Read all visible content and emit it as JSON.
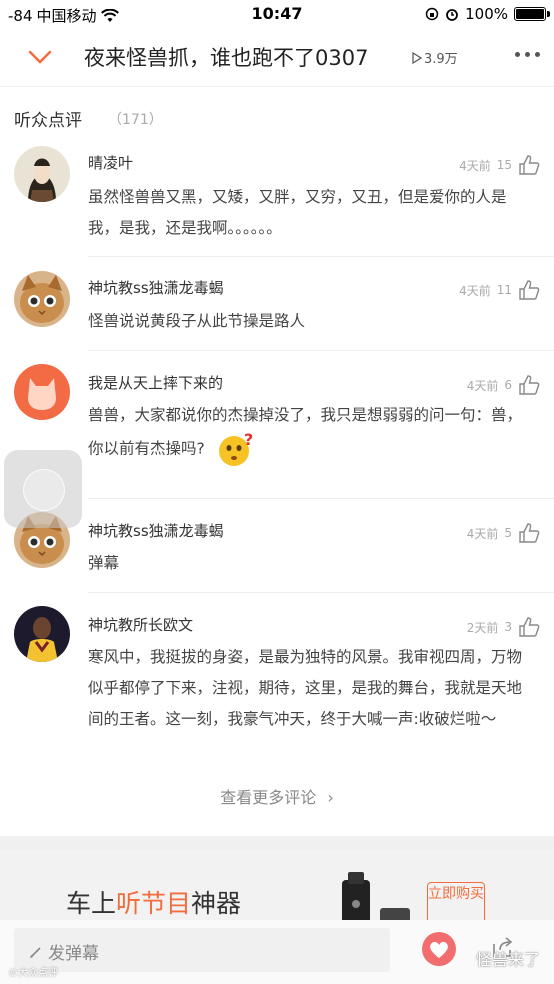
{
  "status_bar": {
    "signal": "-84",
    "carrier": "中国移动",
    "time": "10:47",
    "battery": "100%"
  },
  "header": {
    "title": "夜来怪兽抓，谁也跑不了0307",
    "plays": "3.9万"
  },
  "section": {
    "title": "听众点评",
    "count": "（171）"
  },
  "comments": [
    {
      "name": "晴凌叶",
      "time": "4天前",
      "likes": "15",
      "text": "虽然怪兽兽又黑，又矮，又胖，又穷，又丑，但是爱你的人是我，是我，还是我啊。。。。。。"
    },
    {
      "name": "神坑教ss独潇龙毒蝎",
      "time": "4天前",
      "likes": "11",
      "text": "怪兽说说黄段子从此节操是路人"
    },
    {
      "name": "我是从天上摔下来的",
      "time": "4天前",
      "likes": "6",
      "text": "兽兽，大家都说你的杰操掉没了，我只是想弱弱的问一句：兽，你以前有杰操吗?"
    },
    {
      "name": "神坑教ss独潇龙毒蝎",
      "time": "4天前",
      "likes": "5",
      "text": "弹幕"
    },
    {
      "name": "神坑教所长欧文",
      "time": "2天前",
      "likes": "3",
      "text": "寒风中，我挺拔的身姿，是最为独特的风景。我审视四周，万物似乎都停了下来，注视，期待，这里，是我的舞台，我就是天地间的王者。这一刻，我豪气冲天，终于大喊一声:收破烂啦～"
    }
  ],
  "more_comments": "查看更多评论",
  "ad": {
    "prefix": "车上",
    "highlight": "听节目",
    "suffix": "神器",
    "button": "立即购买"
  },
  "bottom": {
    "danmu_placeholder": "发弹幕",
    "watermark": "怪兽来了",
    "watermark_small": "©大众点评"
  },
  "colors": {
    "accent": "#f26d3d",
    "background": "#ffffff"
  }
}
